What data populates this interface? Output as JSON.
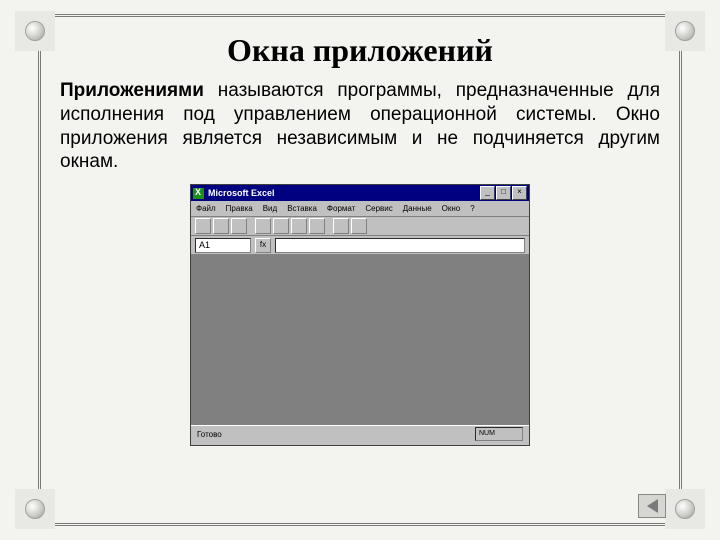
{
  "slide": {
    "title": "Окна приложений",
    "paragraph_bold": "Приложениями",
    "paragraph_rest": " называются программы, предназначенные для исполнения под управлением операционной системы. Окно приложения является независимым и не подчиняется другим окнам."
  },
  "excel": {
    "title": "Microsoft Excel",
    "menus": [
      "Файл",
      "Правка",
      "Вид",
      "Вставка",
      "Формат",
      "Сервис",
      "Данные",
      "Окно",
      "?"
    ],
    "cell_ref": "A1",
    "fx_label": "fx",
    "status_left": "Готово",
    "status_panel": "NUM"
  },
  "nav": {
    "back_label": "◀"
  }
}
